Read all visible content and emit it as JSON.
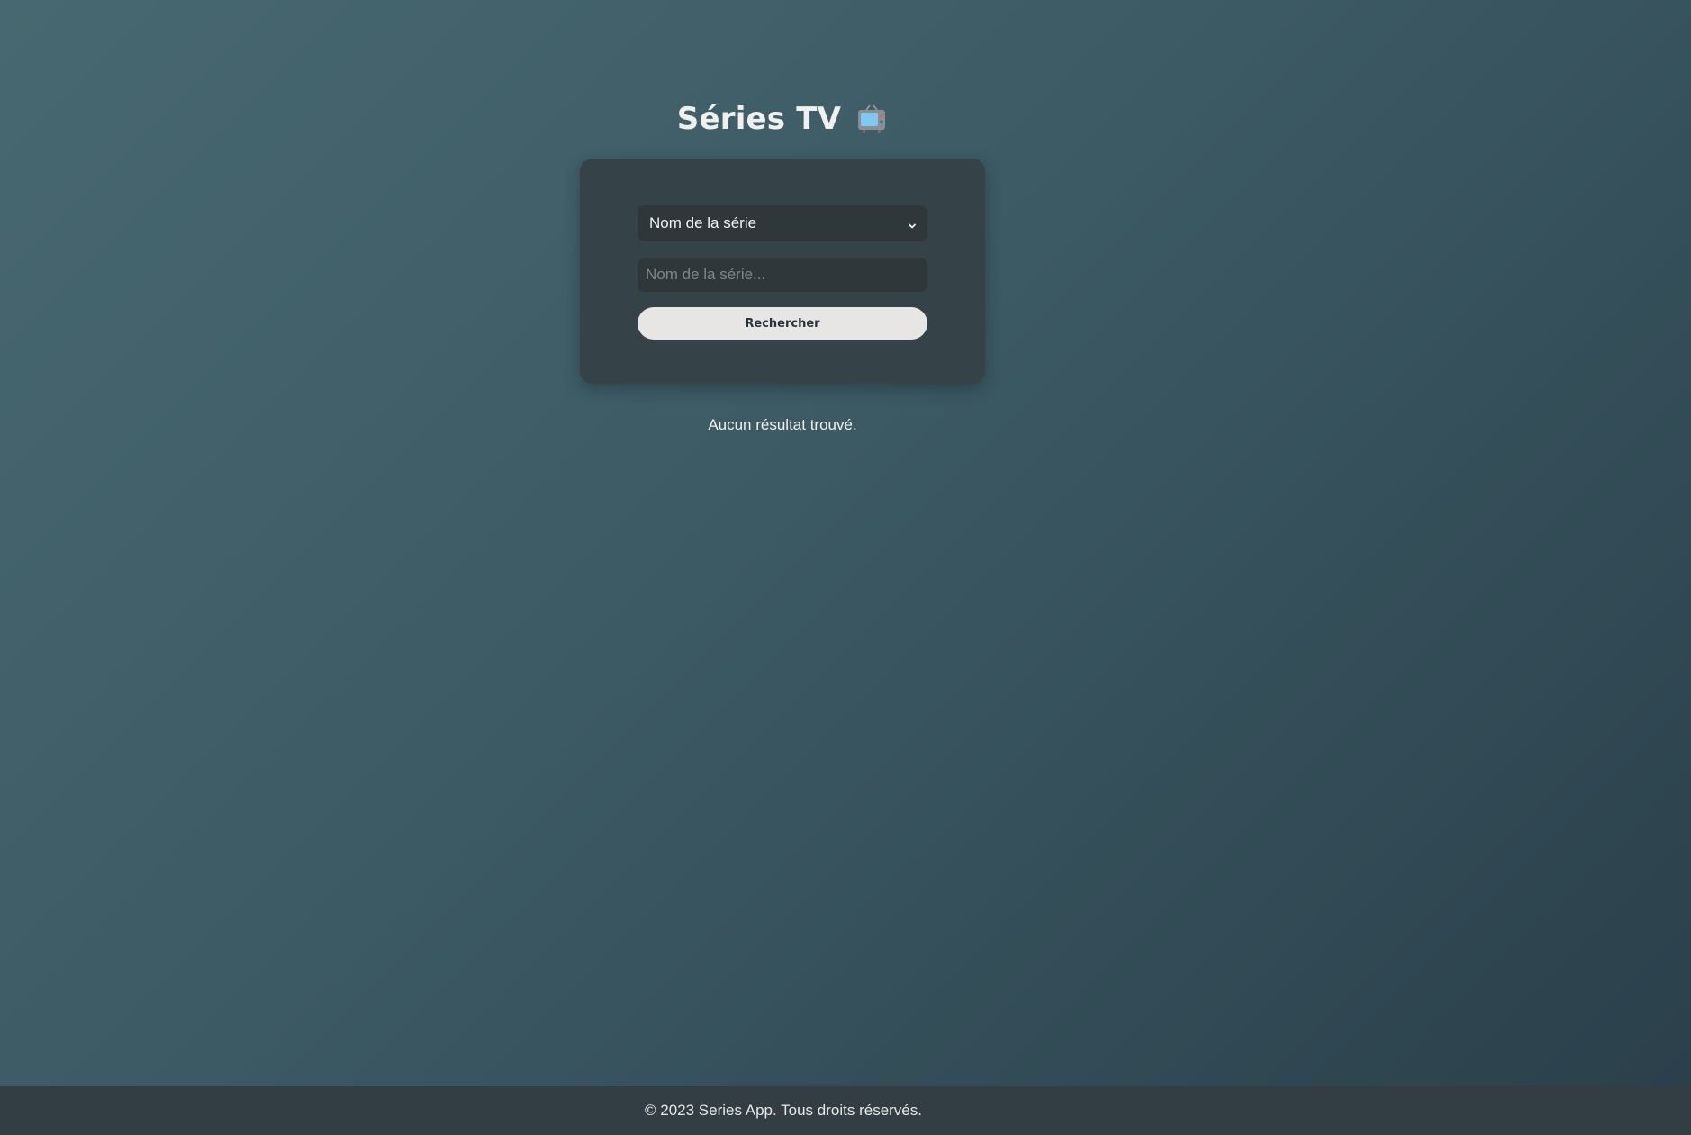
{
  "header": {
    "title": "Séries TV",
    "icon": "television-icon"
  },
  "search": {
    "select_value": "Nom de la série",
    "select_icon": "chevron-down-icon",
    "input_placeholder": "Nom de la série...",
    "input_value": "",
    "button_label": "Rechercher"
  },
  "results": {
    "message": "Aucun résultat trouvé."
  },
  "footer": {
    "text": "© 2023 Series App. Tous droits réservés."
  },
  "colors": {
    "card_background": "#354349",
    "field_background": "#2f373b",
    "button_background": "#e8e6e5",
    "button_text": "#27343a",
    "footer_background": "#333e44"
  }
}
